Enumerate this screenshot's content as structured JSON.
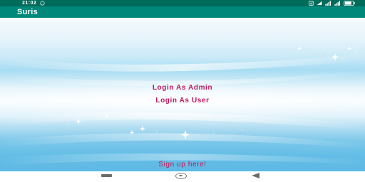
{
  "status_bar": {
    "time": "21:02",
    "left_icon": "whatsapp-icon",
    "right_icons": [
      "alarm-icon",
      "sim-icon",
      "signal-icon",
      "signal-icon",
      "battery-icon"
    ],
    "background_color": "#006b5a"
  },
  "app_bar": {
    "title": "Suris",
    "background_color": "#00897b"
  },
  "main": {
    "login_admin_label": "Login As Admin",
    "login_user_label": "Login As User",
    "signup_label": "Sign up here!",
    "link_color": "#c2185b"
  },
  "nav_bar": {
    "buttons": [
      "recent-apps-icon",
      "home-icon",
      "back-icon"
    ]
  }
}
